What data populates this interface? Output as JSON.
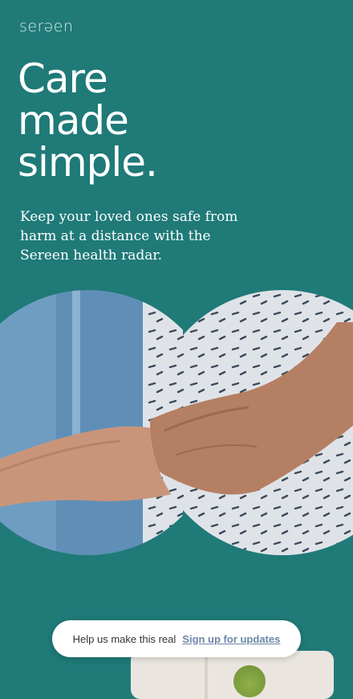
{
  "brand": {
    "logo": "serəen"
  },
  "hero": {
    "headline_lines": [
      "Care",
      "made",
      "simple."
    ],
    "tagline": "Keep your loved ones safe from harm at a distance with the Sereen health radar.",
    "image_icon": "holding-hands-photo"
  },
  "cta": {
    "text": "Help us make this real",
    "link_label": "Sign up for updates"
  },
  "colors": {
    "background": "#1f7a78",
    "text": "#ffffff",
    "link": "#6b86a8",
    "pill": "#ffffff"
  }
}
